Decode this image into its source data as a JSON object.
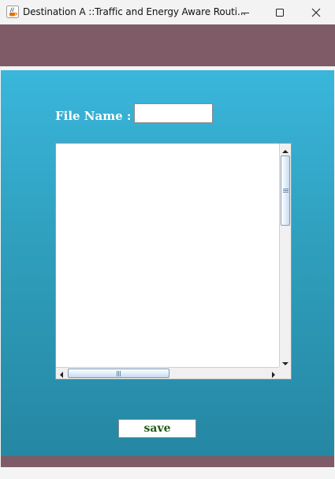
{
  "window": {
    "title": "Destination A ::Traffic and Energy Aware Routi...",
    "app_icon": "java-cup-icon",
    "controls": {
      "minimize": "minimize-icon",
      "maximize": "maximize-icon",
      "close": "close-icon"
    }
  },
  "form": {
    "file_name_label": "File Name :",
    "file_name_value": "",
    "text_content": "",
    "save_label": "save"
  },
  "colors": {
    "band": "#7e5b66",
    "panel_top": "#3ab6dc",
    "panel_bottom": "#2587a3",
    "save_text": "#1d5a12"
  }
}
